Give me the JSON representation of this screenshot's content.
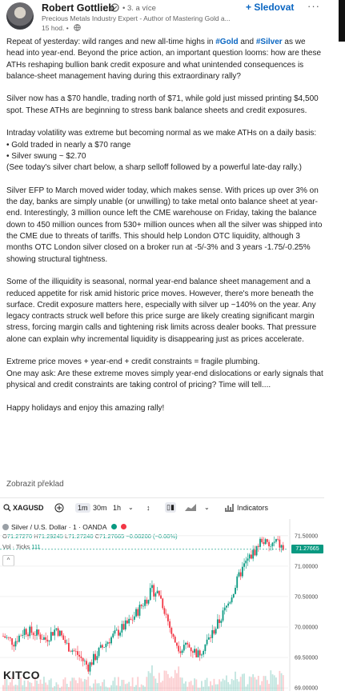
{
  "author": {
    "name": "Robert Gottlieb",
    "degree": "• 3. a více",
    "headline": "Precious Metals Industry Expert - Author of Mastering Gold a...",
    "time": "15 hod. •",
    "follow_label": "+ Sledovat",
    "more_label": "···"
  },
  "post": {
    "p1_a": "Repeat of yesterday: wild ranges and new all-time highs in ",
    "tag_gold": "#Gold",
    "p1_and": " and ",
    "tag_silver": "#Silver",
    "p1_b": " as we head into year-end. Beyond the price action, an important question looms: how are these ATHs reshaping bullion bank credit exposure and what unintended consequences is balance-sheet management having during this extraordinary rally?",
    "p2": "Silver now has a $70 handle, trading north of $71, while gold just missed printing $4,500 spot. These ATHs are beginning to stress bank balance sheets and credit exposures.",
    "p3": "Intraday volatility was extreme but becoming normal as we make ATHs on a daily basis:",
    "p3_b1": " • Gold traded in nearly a $70 range",
    "p3_b2": " • Silver swung ~ $2.70",
    "p3_c": "(See today's silver chart below, a sharp selloff followed by a powerful late-day rally.)",
    "p4": "Silver EFP to March moved wider today, which makes sense. With prices up over 3% on the day, banks are simply unable (or unwilling) to take metal onto balance sheet at year-end. Interestingly, 3 million ounce left the CME warehouse on Friday, taking the balance down to 450 million ounces from 530+ million ounces when all the silver was shipped into the CME due to threats of tariffs. This should help London OTC liquidity, although 3 months OTC London silver closed on a broker run at -5/-3% and 3 years -1.75/-0.25% showing structural tightness.",
    "p5": "Some of the illiquidity is seasonal, normal year-end balance sheet management and a reduced appetite for risk amid historic price moves. However, there's more beneath the surface. Credit exposure matters here, especially with silver up ~140% on the year. Any legacy contracts struck well before this price surge are likely creating significant margin stress, forcing margin calls and tightening risk limits across dealer books. That pressure alone can explain why incremental liquidity is disappearing just as prices accelerate.",
    "p6_a": "Extreme price moves + year-end + credit constraints = fragile plumbing.",
    "p6_b": "One may ask: Are these extreme moves simply year-end dislocations or early signals that physical and credit constraints are taking control of pricing? Time will tell....",
    "p7": "Happy holidays and enjoy this amazing rally!",
    "show_translation": "Zobrazit překlad"
  },
  "chart": {
    "symbol": "XAGUSD",
    "timeframes": [
      "1m",
      "30m",
      "1h"
    ],
    "indicators_label": "Indicators",
    "title": "Silver / U.S. Dollar · 1 · OANDA",
    "ohlc": {
      "o_label": "O",
      "o": "71.27270",
      "h_label": "H",
      "h": "71.29245",
      "l_label": "L",
      "l": "71.27240",
      "c_label": "C",
      "c": "71.27665",
      "chg": "−0.00200 (−0.00%)"
    },
    "volume_label": "Vol · Ticks",
    "volume_value": "111",
    "last_price": "71.27665",
    "brand": "KITCO",
    "colors": {
      "up": "#089981",
      "down": "#f23645",
      "price_tag": "#089981"
    }
  },
  "chart_data": {
    "type": "candlestick",
    "title": "Silver / U.S. Dollar · 1 · OANDA",
    "y_tick_labels": [
      "71.50000",
      "71.00000",
      "70.50000",
      "70.00000",
      "69.50000",
      "69.00000"
    ],
    "ylim": [
      68.95,
      71.72
    ],
    "last_price": 71.27665,
    "close_path": [
      {
        "i": 0,
        "c": 69.85
      },
      {
        "i": 6,
        "c": 69.75
      },
      {
        "i": 12,
        "c": 69.95
      },
      {
        "i": 18,
        "c": 69.9
      },
      {
        "i": 24,
        "c": 69.8
      },
      {
        "i": 30,
        "c": 69.98
      },
      {
        "i": 36,
        "c": 69.7
      },
      {
        "i": 42,
        "c": 69.55
      },
      {
        "i": 48,
        "c": 69.35
      },
      {
        "i": 54,
        "c": 69.6
      },
      {
        "i": 60,
        "c": 69.8
      },
      {
        "i": 66,
        "c": 69.95
      },
      {
        "i": 72,
        "c": 70.1
      },
      {
        "i": 78,
        "c": 70.35
      },
      {
        "i": 84,
        "c": 70.6
      },
      {
        "i": 88,
        "c": 70.55
      },
      {
        "i": 92,
        "c": 70.2
      },
      {
        "i": 96,
        "c": 69.8
      },
      {
        "i": 100,
        "c": 69.65
      },
      {
        "i": 104,
        "c": 69.7
      },
      {
        "i": 110,
        "c": 69.55
      },
      {
        "i": 116,
        "c": 69.8
      },
      {
        "i": 122,
        "c": 70.1
      },
      {
        "i": 128,
        "c": 70.45
      },
      {
        "i": 134,
        "c": 70.9
      },
      {
        "i": 138,
        "c": 71.1
      },
      {
        "i": 142,
        "c": 71.25
      },
      {
        "i": 146,
        "c": 71.45
      },
      {
        "i": 150,
        "c": 71.3
      },
      {
        "i": 154,
        "c": 71.4
      },
      {
        "i": 158,
        "c": 71.28
      }
    ]
  }
}
